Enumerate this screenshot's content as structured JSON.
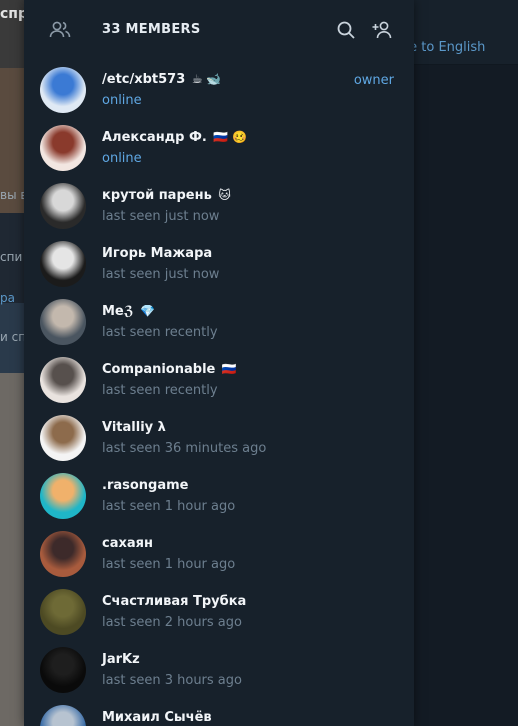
{
  "background": {
    "translate_link": "ce to English",
    "left_snippets": [
      "спр",
      "вы в",
      "спи",
      "ра",
      "и сп"
    ]
  },
  "panel": {
    "title": "33 MEMBERS",
    "icons": {
      "members": "members-icon",
      "search": "search-icon",
      "add_member": "add-member-icon"
    }
  },
  "members": [
    {
      "name": "/etc/xbt573",
      "emoji": "☕ 🐋",
      "status": "online",
      "online": true,
      "role": "owner",
      "avatar_colors": [
        "#dfe9f4",
        "#3b7ad4"
      ]
    },
    {
      "name": "Александр Ф.",
      "emoji": "🇷🇺 🥴",
      "status": "online",
      "online": true,
      "role": "",
      "avatar_colors": [
        "#f2e6e1",
        "#8a3a2c"
      ]
    },
    {
      "name": "крутой парень",
      "emoji": "🐱",
      "status": "last seen just now",
      "online": false,
      "role": "",
      "avatar_colors": [
        "#2a2a2a",
        "#d8d8d8"
      ]
    },
    {
      "name": "Игорь Мажара",
      "emoji": "",
      "status": "last seen just now",
      "online": false,
      "role": "",
      "avatar_colors": [
        "#1b1b1b",
        "#e5e5e5"
      ]
    },
    {
      "name": "Meℨ",
      "emoji": "💎",
      "status": "last seen recently",
      "online": false,
      "role": "",
      "avatar_colors": [
        "#4a5560",
        "#c3b8ad"
      ]
    },
    {
      "name": "Companionable",
      "emoji": "🇷🇺",
      "status": "last seen recently",
      "online": false,
      "role": "",
      "avatar_colors": [
        "#e9e3df",
        "#57504d"
      ]
    },
    {
      "name": "Vitalliy λ",
      "emoji": "",
      "status": "last seen 36 minutes ago",
      "online": false,
      "role": "",
      "avatar_colors": [
        "#f4f4f4",
        "#8d6b4c"
      ]
    },
    {
      "name": ".rasongame",
      "emoji": "",
      "status": "last seen 1 hour ago",
      "online": false,
      "role": "",
      "avatar_colors": [
        "#1fb6c8",
        "#f0b16b"
      ]
    },
    {
      "name": "сахаян",
      "emoji": "",
      "status": "last seen 1 hour ago",
      "online": false,
      "role": "",
      "avatar_colors": [
        "#a85b3d",
        "#3d2a2a"
      ]
    },
    {
      "name": "Счастливая Трубка",
      "emoji": "",
      "status": "last seen 2 hours ago",
      "online": false,
      "role": "",
      "avatar_colors": [
        "#4d4a23",
        "#6e6a36"
      ]
    },
    {
      "name": "JarKz",
      "emoji": "",
      "status": "last seen 3 hours ago",
      "online": false,
      "role": "",
      "avatar_colors": [
        "#0a0a0a",
        "#1e1e1e"
      ]
    },
    {
      "name": "Михаил Сычёв",
      "emoji": "",
      "status": "",
      "online": false,
      "role": "",
      "avatar_colors": [
        "#3c6ea8",
        "#b7c3d0"
      ]
    }
  ]
}
